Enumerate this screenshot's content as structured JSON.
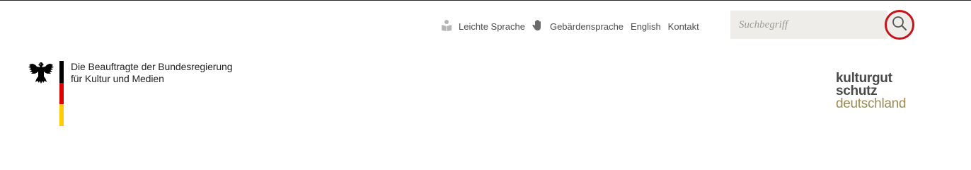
{
  "service_nav": {
    "items": [
      {
        "label": "Leichte Sprache",
        "icon": "easy-language-book-icon"
      },
      {
        "label": "Gebärdensprache",
        "icon": "hand-sign-icon"
      },
      {
        "label": "English"
      },
      {
        "label": "Kontakt"
      }
    ]
  },
  "search": {
    "placeholder": "Suchbegriff",
    "button_icon": "magnifier-icon"
  },
  "logo_bkm": {
    "line1": "Die Beauftragte der Bundesregierung",
    "line2": "für Kultur und Medien",
    "flag_colors": [
      "#000000",
      "#dd0000",
      "#ffcc00"
    ]
  },
  "logo_kgs": {
    "line1": "kulturgut",
    "line2": "schutz",
    "line3": "deutschland",
    "colors": {
      "dark": "#4a4a4a",
      "accent": "#9a8c55"
    }
  },
  "colors": {
    "search_bg": "#efedea",
    "search_ring": "#c6141b",
    "nav_text": "#4d4d4d"
  }
}
